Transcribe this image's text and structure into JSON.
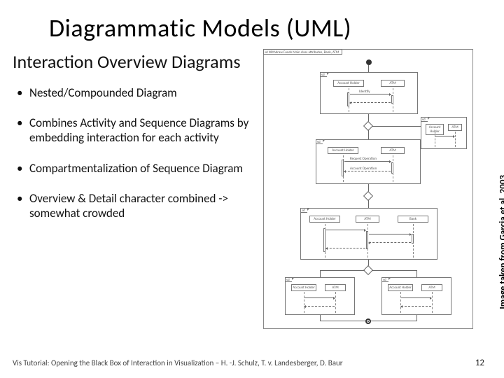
{
  "title": "Diagrammatic Models (UML)",
  "subheading": "Interaction Overview Diagrams",
  "bullets": [
    "Nested/Compounded Diagram",
    "Combines Activity and Sequence Diagrams by embedding interaction for each activity",
    "Compartmentalization of Sequence Diagram",
    "Overview & Detail character combined -> somewhat crowded"
  ],
  "diagram": {
    "outer_tab": "sd  Withdraw Funds Main  class attributes, Bank, ATM",
    "frames": {
      "f1_tab": "sd",
      "f2_tab": "sd",
      "f3_tab": "sd",
      "f4_tab": "sd",
      "f5_tab": "sd",
      "lifeline_a": "Account Holder",
      "lifeline_b": "ATM",
      "lifeline_c": "Account Holder",
      "lifeline_d": "ATM",
      "mid_a": "Account Holder",
      "mid_b": "ATM",
      "bot_a": "Account Holder",
      "bot_b": "ATM",
      "msg1": "Identify",
      "msg2": "Request Operation",
      "msg3": "Account Operation"
    }
  },
  "attribution": "Image taken from Garcia et al. 2003",
  "footer_text": "Vis Tutorial: Opening the Black Box of Interaction in Visualization – H. -J. Schulz, T. v. Landesberger, D. Baur",
  "page_number": "12"
}
